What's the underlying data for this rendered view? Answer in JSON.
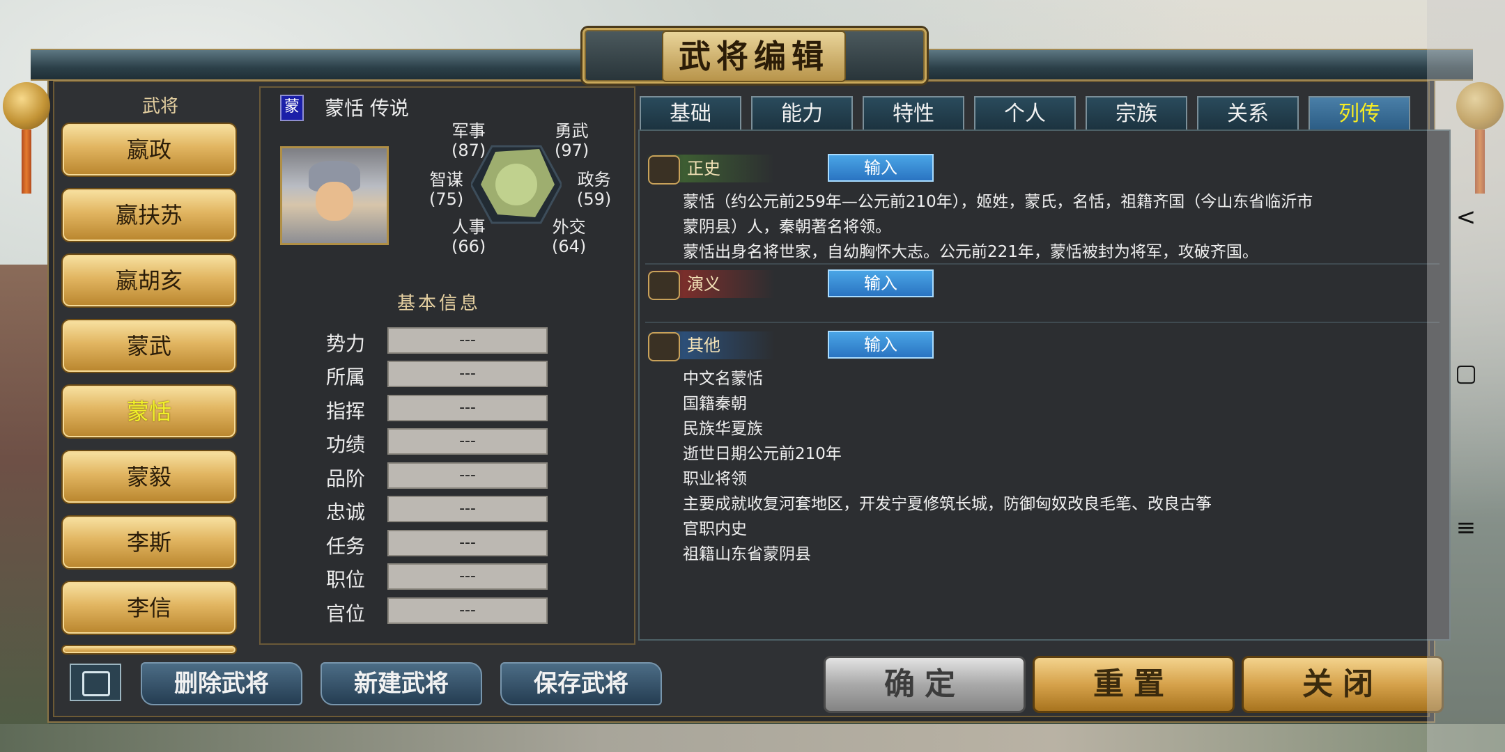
{
  "window": {
    "title": "武将编辑"
  },
  "sidebar": {
    "header": "武将",
    "items": [
      {
        "label": "嬴政"
      },
      {
        "label": "嬴扶苏"
      },
      {
        "label": "嬴胡亥"
      },
      {
        "label": "蒙武"
      },
      {
        "label": "蒙恬"
      },
      {
        "label": "蒙毅"
      },
      {
        "label": "李斯"
      },
      {
        "label": "李信"
      }
    ],
    "active_item": "蒙恬"
  },
  "general": {
    "flag": "蒙",
    "name_line": "蒙恬 传说",
    "stats": {
      "military": {
        "label": "军事",
        "value": "(87)"
      },
      "valor": {
        "label": "勇武",
        "value": "(97)"
      },
      "strategy": {
        "label": "智谋",
        "value": "(75)"
      },
      "politics": {
        "label": "政务",
        "value": "(59)"
      },
      "personnel": {
        "label": "人事",
        "value": "(66)"
      },
      "diplomacy": {
        "label": "外交",
        "value": "(64)"
      }
    }
  },
  "basic_info": {
    "title": "基本信息",
    "rows": [
      {
        "label": "势力",
        "value": "---"
      },
      {
        "label": "所属",
        "value": "---"
      },
      {
        "label": "指挥",
        "value": "---"
      },
      {
        "label": "功绩",
        "value": "---"
      },
      {
        "label": "品阶",
        "value": "---"
      },
      {
        "label": "忠诚",
        "value": "---"
      },
      {
        "label": "任务",
        "value": "---"
      },
      {
        "label": "职位",
        "value": "---"
      },
      {
        "label": "官位",
        "value": "---"
      }
    ]
  },
  "tabs": [
    {
      "label": "基础"
    },
    {
      "label": "能力"
    },
    {
      "label": "特性"
    },
    {
      "label": "个人"
    },
    {
      "label": "宗族"
    },
    {
      "label": "关系"
    },
    {
      "label": "列传"
    }
  ],
  "active_tab": "列传",
  "biography": {
    "input_label": "输入",
    "official": {
      "title": "正史",
      "lines": [
        "蒙恬（约公元前259年—公元前210年），姬姓，蒙氏，名恬，祖籍齐国（今山东省临沂市",
        "蒙阴县）人，秦朝著名将领。",
        "蒙恬出身名将世家，自幼胸怀大志。公元前221年，蒙恬被封为将军，攻破齐国。"
      ]
    },
    "romance": {
      "title": "演义",
      "lines": []
    },
    "other": {
      "title": "其他",
      "lines": [
        "中文名蒙恬",
        "国籍秦朝",
        "民族华夏族",
        "逝世日期公元前210年",
        "职业将领",
        "主要成就收复河套地区，开发宁夏修筑长城，防御匈奴改良毛笔、改良古筝",
        "官职内史",
        "祖籍山东省蒙阴县"
      ]
    }
  },
  "bottom": {
    "delete": "删除武将",
    "create": "新建武将",
    "save": "保存武将",
    "confirm": "确定",
    "reset": "重置",
    "close": "关闭"
  },
  "system_nav": {
    "back": "<",
    "home": "▢",
    "menu": "≡"
  },
  "colors": {
    "active_text": "#f1f02a",
    "gold": "#d6a24b",
    "input_blue": "#2a74c2"
  }
}
